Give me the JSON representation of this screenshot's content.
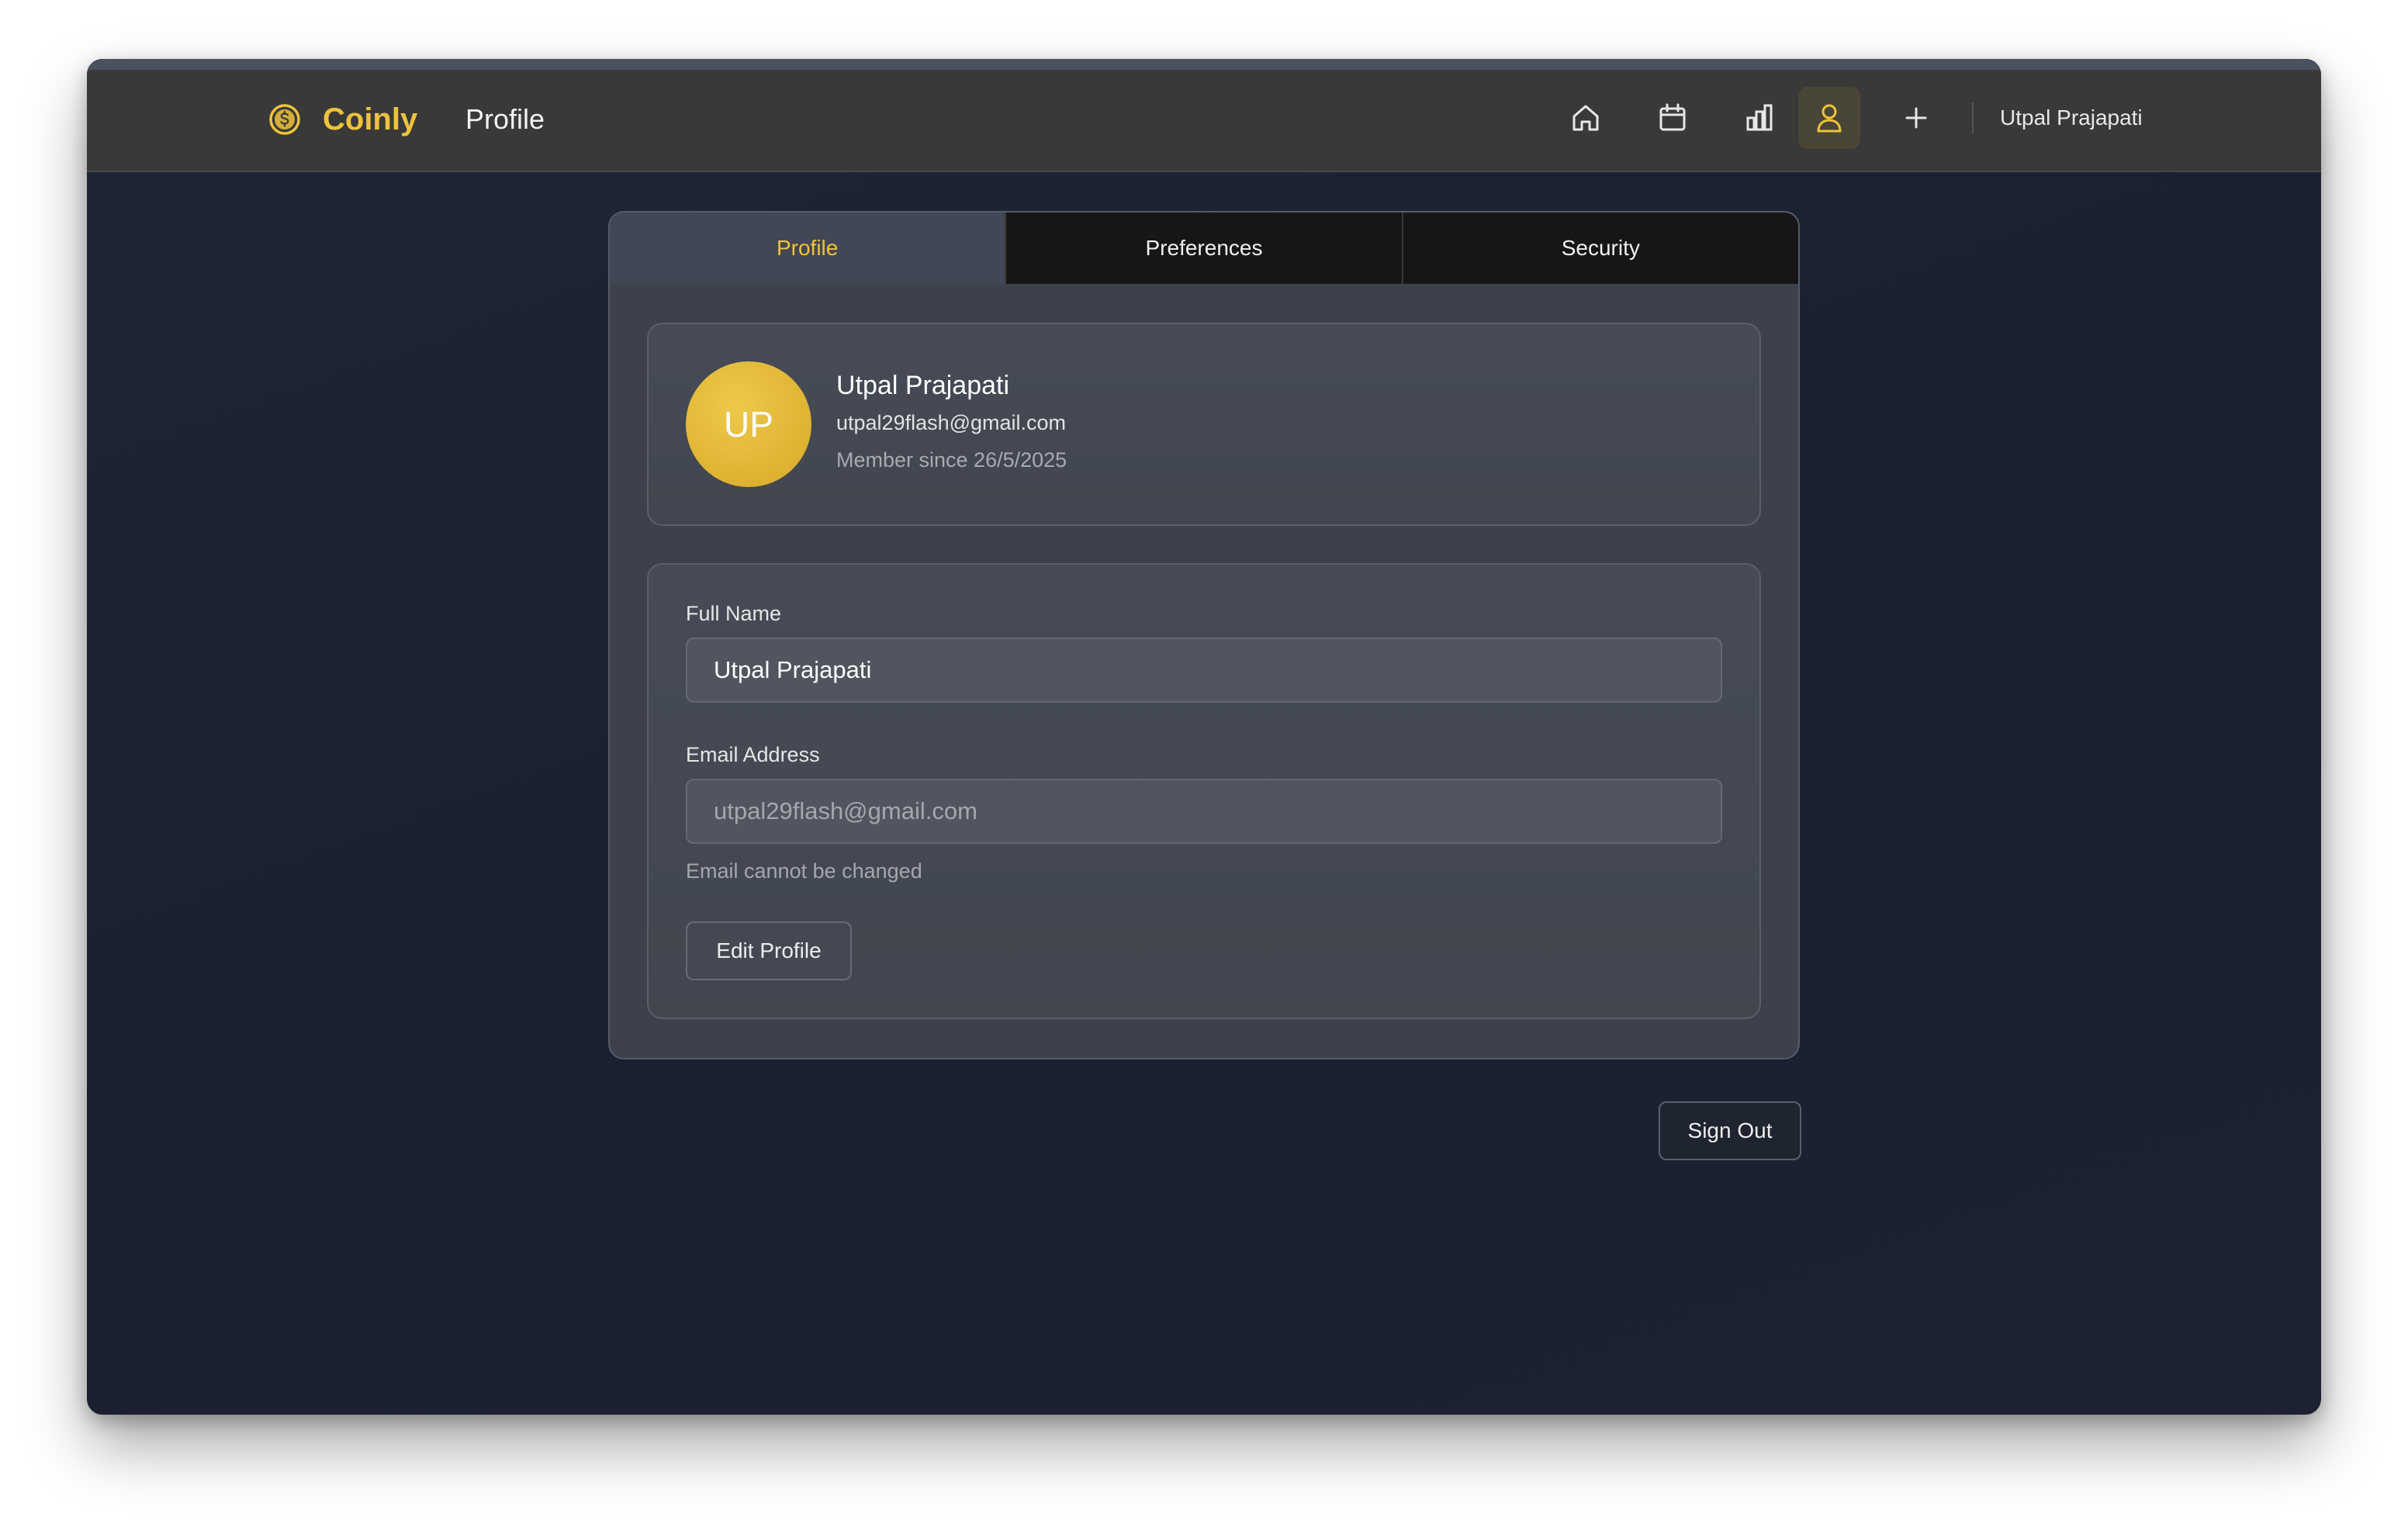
{
  "header": {
    "brand_name": "Coinly",
    "page_title": "Profile",
    "brand_color": "#eec33a",
    "nav": [
      {
        "name": "home",
        "icon": "home-icon",
        "active": false
      },
      {
        "name": "calendar",
        "icon": "calendar-icon",
        "active": false
      },
      {
        "name": "analytics",
        "icon": "bar-chart-icon",
        "active": false
      },
      {
        "name": "profile",
        "icon": "user-icon",
        "active": true
      },
      {
        "name": "add",
        "icon": "plus-icon",
        "active": false
      }
    ],
    "user_name": "Utpal Prajapati"
  },
  "tabs": [
    {
      "label": "Profile",
      "active": true
    },
    {
      "label": "Preferences",
      "active": false
    },
    {
      "label": "Security",
      "active": false
    }
  ],
  "profile": {
    "initials": "UP",
    "name": "Utpal Prajapati",
    "email": "utpal29flash@gmail.com",
    "member_since": "Member since 26/5/2025"
  },
  "form": {
    "full_name_label": "Full Name",
    "full_name_value": "Utpal Prajapati",
    "email_label": "Email Address",
    "email_value": "utpal29flash@gmail.com",
    "email_hint": "Email cannot be changed",
    "edit_button": "Edit Profile"
  },
  "actions": {
    "sign_out": "Sign Out"
  }
}
